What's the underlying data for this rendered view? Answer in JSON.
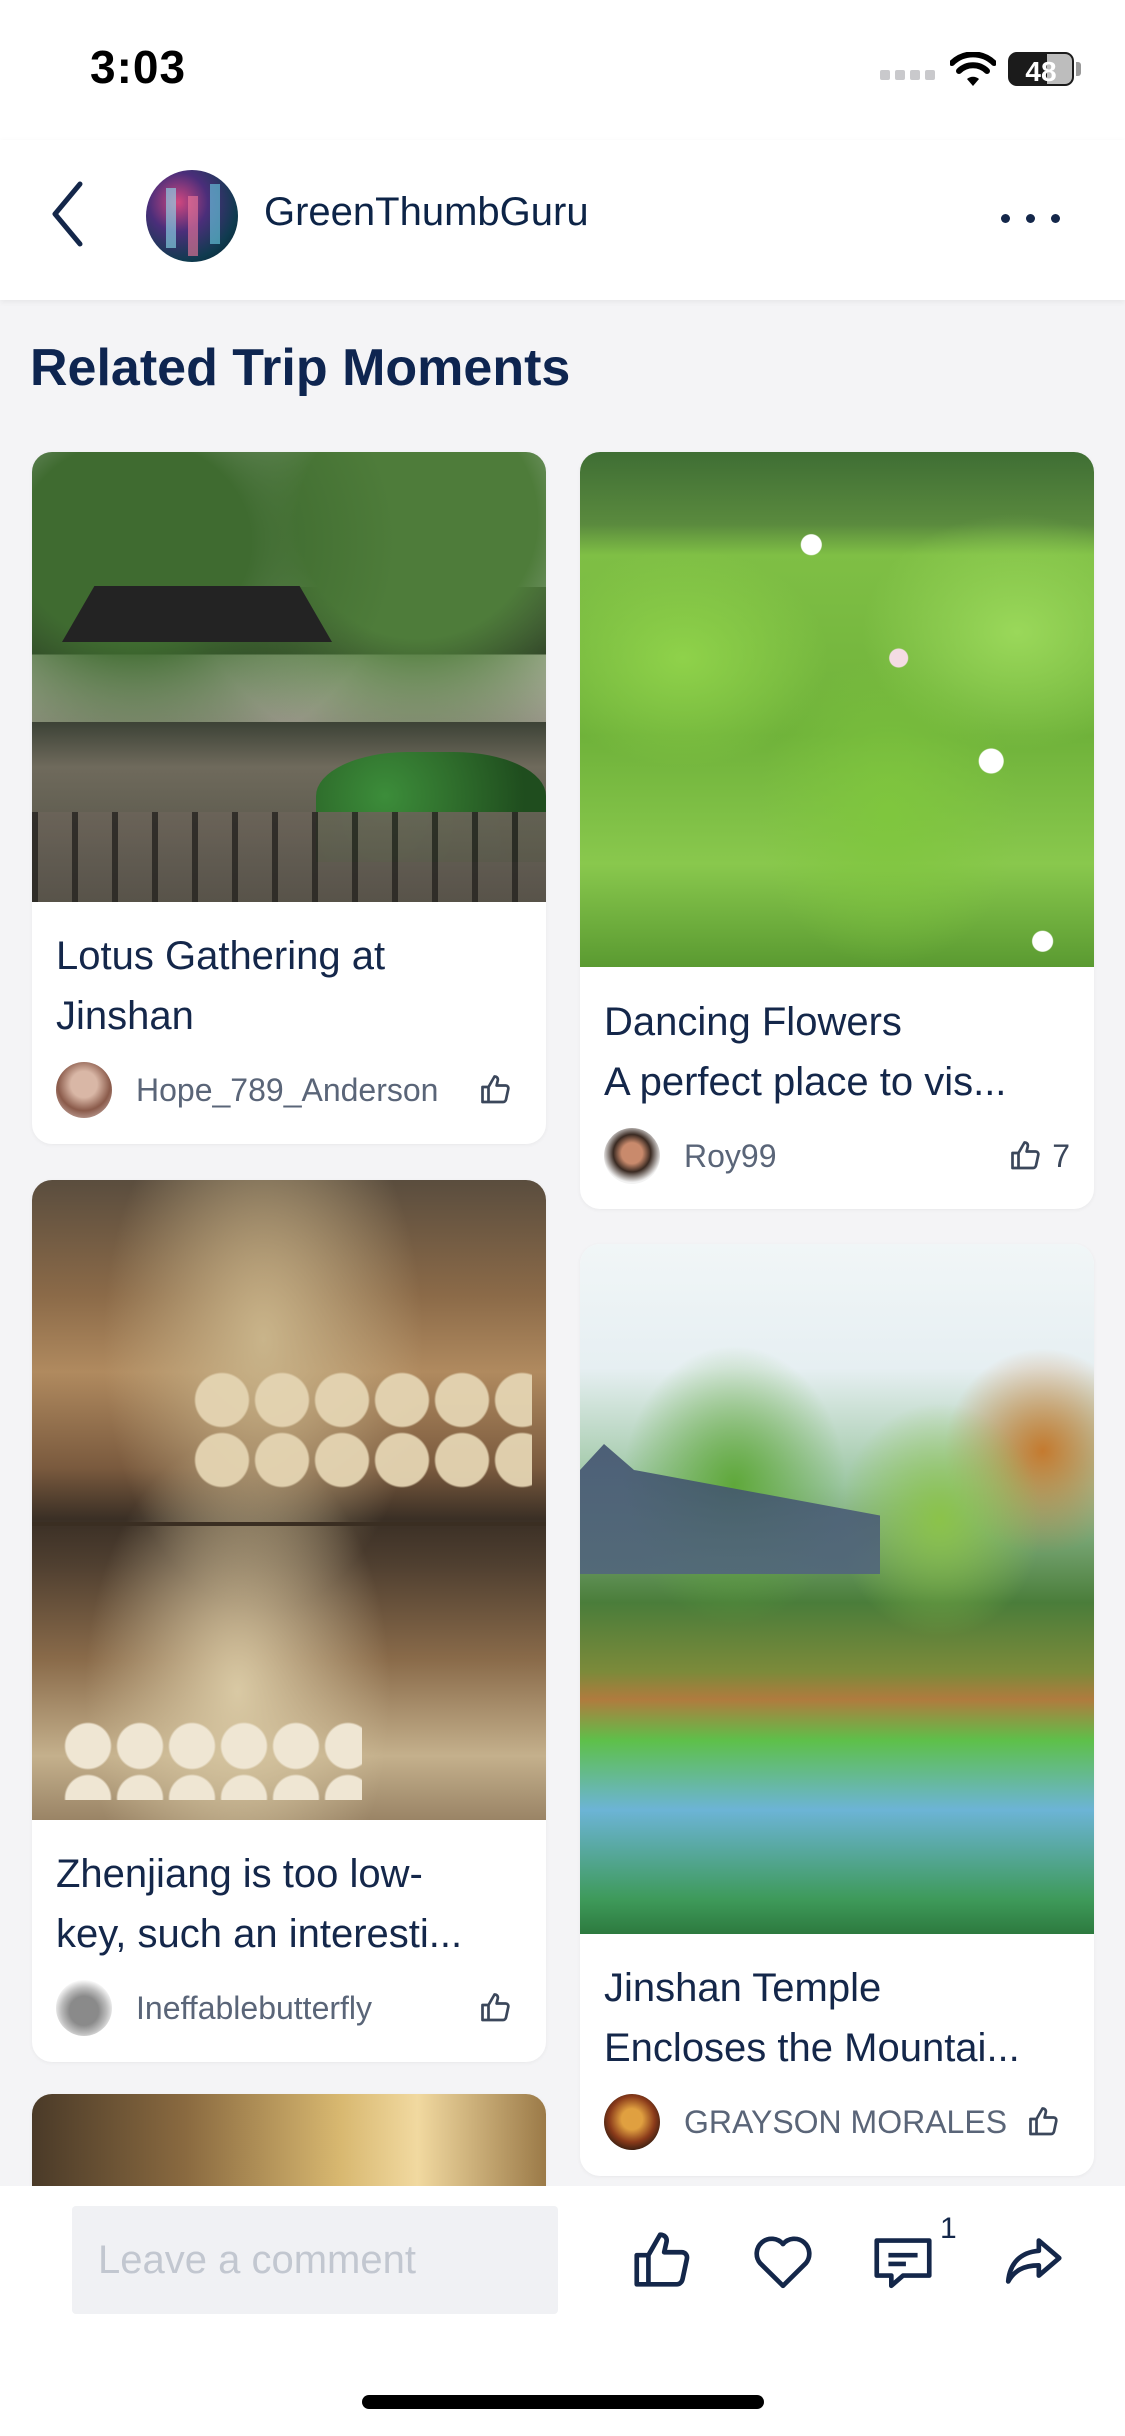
{
  "status_bar": {
    "time": "3:03",
    "battery": "48"
  },
  "header": {
    "username": "GreenThumbGuru"
  },
  "section": {
    "title": "Related Trip Moments"
  },
  "cards": [
    {
      "title_line1": "Lotus Gathering at",
      "title_line2": "Jinshan",
      "author": "Hope_789_Anderson",
      "likes": ""
    },
    {
      "title_line1": "Dancing Flowers",
      "title_line2": "A perfect place to vis...",
      "author": "Roy99",
      "likes": "7"
    },
    {
      "title_line1": "Zhenjiang is too low-",
      "title_line2": "key, such an interesti...",
      "author": "Ineffablebutterfly",
      "likes": ""
    },
    {
      "title_line1": "Jinshan Temple",
      "title_line2": "Encloses the Mountai...",
      "author": "GRAYSON MORALES",
      "likes": ""
    }
  ],
  "bottom_bar": {
    "comment_placeholder": "Leave a comment",
    "comment_count": "1"
  },
  "icons": [
    "back-icon",
    "more-icon",
    "thumbs-up-icon",
    "heart-icon",
    "comment-icon",
    "share-icon"
  ],
  "colors": {
    "text_primary": "#14274a",
    "background": "#f4f4f6",
    "card": "#ffffff"
  }
}
